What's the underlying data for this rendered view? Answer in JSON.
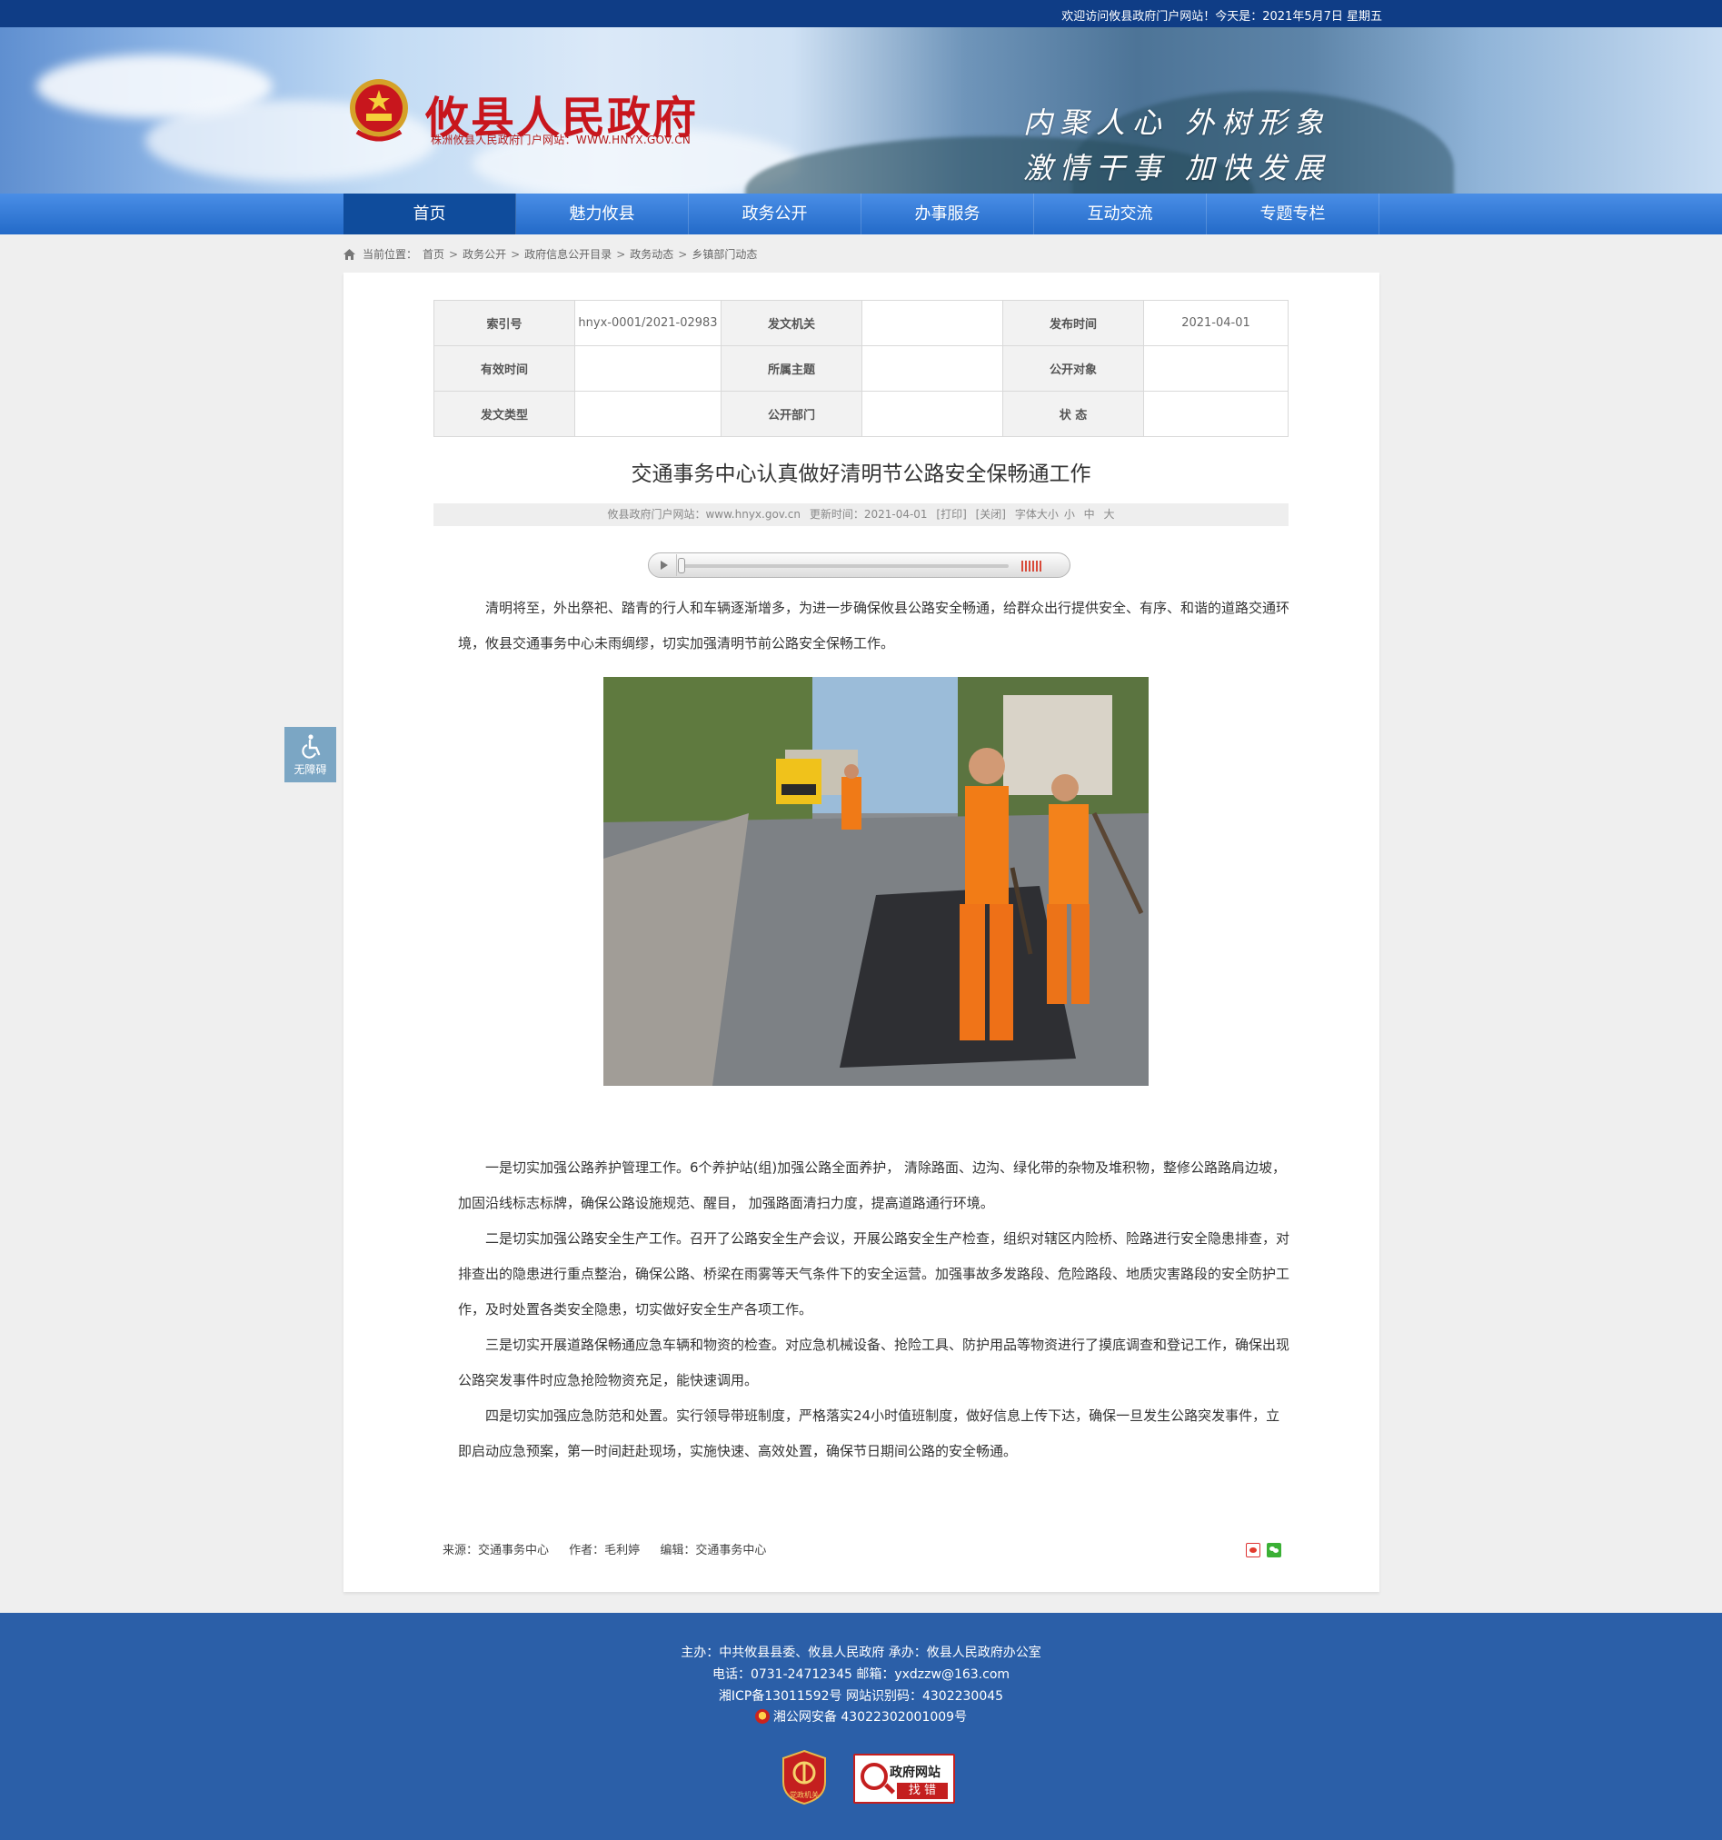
{
  "topbar": {
    "welcome": "欢迎访问攸县政府门户网站！今天是：2021年5月7日 星期五"
  },
  "header": {
    "title": "攸县人民政府",
    "subtitle": "株洲攸县人民政府门户网站：WWW.HNYX.GOV.CN",
    "slogan_line1": "内聚人心 外树形象",
    "slogan_line2": "激情干事 加快发展"
  },
  "nav": {
    "items": [
      {
        "label": "首页",
        "active": true
      },
      {
        "label": "魅力攸县"
      },
      {
        "label": "政务公开"
      },
      {
        "label": "办事服务"
      },
      {
        "label": "互动交流"
      },
      {
        "label": "专题专栏"
      }
    ]
  },
  "breadcrumb": {
    "prefix": "当前位置：",
    "items": [
      "首页",
      "政务公开",
      "政府信息公开目录",
      "政务动态",
      "乡镇部门动态"
    ],
    "separator": ">"
  },
  "meta": {
    "row1": {
      "k1": "索引号",
      "v1": "hnyx-0001/2021-02983",
      "k2": "发文机关",
      "v2": "",
      "k3": "发布时间",
      "v3": "2021-04-01"
    },
    "row2": {
      "k1": "有效时间",
      "v1": "",
      "k2": "所属主题",
      "v2": "",
      "k3": "公开对象",
      "v3": ""
    },
    "row3": {
      "k1": "发文类型",
      "v1": "",
      "k2": "公开部门",
      "v2": "",
      "k3": "状 态",
      "v3": ""
    }
  },
  "article": {
    "title": "交通事务中心认真做好清明节公路安全保畅通工作",
    "info": {
      "site": "攸县政府门户网站：www.hnyx.gov.cn",
      "updated": "更新时间：2021-04-01",
      "print": "[打印]",
      "close": "[关闭]",
      "fontsize_label": "字体大小",
      "font_small": "小",
      "font_medium": "中",
      "font_large": "大"
    },
    "paragraphs": [
      "清明将至，外出祭祀、踏青的行人和车辆逐渐增多，为进一步确保攸县公路安全畅通，给群众出行提供安全、有序、和谐的道路交通环境，攸县交通事务中心未雨绸缪，切实加强清明节前公路安全保畅工作。",
      "一是切实加强公路养护管理工作。6个养护站(组)加强公路全面养护， 清除路面、边沟、绿化带的杂物及堆积物，整修公路路肩边坡， 加固沿线标志标牌，确保公路设施规范、醒目， 加强路面清扫力度，提高道路通行环境。",
      "二是切实加强公路安全生产工作。召开了公路安全生产会议，开展公路安全生产检查，组织对辖区内险桥、险路进行安全隐患排查，对排查出的隐患进行重点整治，确保公路、桥梁在雨雾等天气条件下的安全运营。加强事故多发路段、危险路段、地质灾害路段的安全防护工作，及时处置各类安全隐患，切实做好安全生产各项工作。",
      "三是切实开展道路保畅通应急车辆和物资的检查。对应急机械设备、抢险工具、防护用品等物资进行了摸底调查和登记工作，确保出现公路突发事件时应急抢险物资充足，能快速调用。",
      "四是切实加强应急防范和处置。实行领导带班制度，严格落实24小时值班制度，做好信息上传下达，确保一旦发生公路突发事件，立即启动应急预案，第一时间赶赴现场，实施快速、高效处置，确保节日期间公路的安全畅通。"
    ],
    "source": "来源：交通事务中心",
    "author": "作者：毛利婷",
    "editor": "编辑：交通事务中心"
  },
  "accessibility": {
    "label": "无障碍"
  },
  "footer": {
    "line1": "主办：中共攸县县委、攸县人民政府 承办：攸县人民政府办公室",
    "line2": "电话：0731-24712345 邮箱：yxdzzw@163.com",
    "line3": "湘ICP备13011592号   网站识别码：4302230045",
    "line4": "湘公网安备 43022302001009号",
    "party_badge_text": "党政机关",
    "err_badge_title": "政府网站",
    "err_badge_action": "找 错"
  },
  "colors": {
    "nav_bg": "#236ac8",
    "nav_active": "#0f4c9c",
    "title_red": "#c8161d",
    "footer_bg": "#2b5fa8"
  }
}
